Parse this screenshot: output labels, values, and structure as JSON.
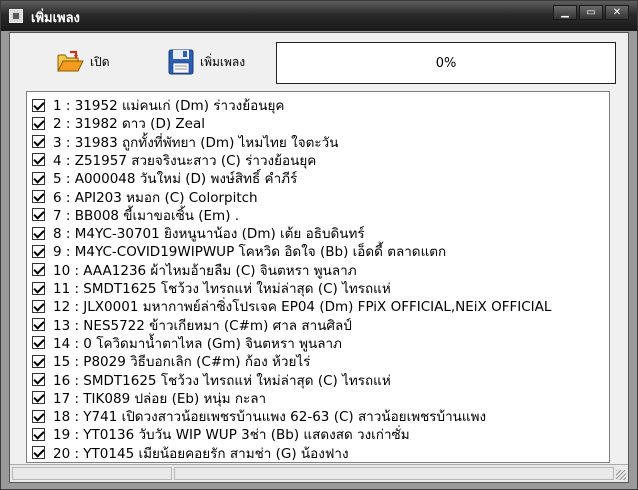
{
  "window": {
    "title": "เพิ่มเพลง",
    "controls": {
      "minimize": "▁",
      "maximize": "▭",
      "close": "✕"
    }
  },
  "toolbar": {
    "open_label": "เปิด",
    "open_icon": "folder-open-icon",
    "add_label": "เพิ่มเพลง",
    "add_icon": "floppy-disk-icon"
  },
  "progress": {
    "text": "0%",
    "value": 0
  },
  "songs": [
    {
      "text": "1 : 31952 แม่คนเก่ (Dm) ร่าวงย้อนยุค",
      "checked": true
    },
    {
      "text": "2 : 31982 ดาว  (D) Zeal",
      "checked": true
    },
    {
      "text": "3 : 31983 ถูกทั้งที่พัทยา  (Dm) ไหมไทย ใจตะวัน",
      "checked": true
    },
    {
      "text": "4 : Z51957 สวยจริงนะสาว (C) ร่าวงย้อนยุค",
      "checked": true
    },
    {
      "text": "5 : A000048 วันใหม่  (D) พงษ์สิทธิ์  คำภีร์",
      "checked": true
    },
    {
      "text": "6 : API203 หมอก (C) Colorpitch",
      "checked": true
    },
    {
      "text": "7 : BB008 ขี้เมาขอเซิ้น (Em) .",
      "checked": true
    },
    {
      "text": "8 : M4YC-30701 ยิงหนูนาน้อง (Dm) เต้ย อธิบดินทร์",
      "checked": true
    },
    {
      "text": "9 : M4YC-COVID19WIPWUP โคหวิด อิดใจ  (Bb) เอ็ดดี้ ตลาดแตก",
      "checked": true
    },
    {
      "text": "10 : AAA1236 ผ้าไหมอ้ายลืม (C) จินตหรา พูนลาภ",
      "checked": true
    },
    {
      "text": "11 : SMDT1625 โชว้วง ไทรถแห่ ใหม่ล่าสุด (C) ไทรถแห่",
      "checked": true
    },
    {
      "text": "12 : JLX0001 มหากาพย์ล่าซิ่งโปรเจค EP04 (Dm) FPiX OFFICIAL,NEiX OFFICIAL",
      "checked": true
    },
    {
      "text": "13 : NES5722 ข้าวเกียหมา (C#m) ศาล สานศิลป์",
      "checked": true
    },
    {
      "text": "14 : 0 โควิดมาน้ำตาไหล (Gm) จินตหรา พูนลาภ",
      "checked": true
    },
    {
      "text": "15 : P8029 วิธีบอกเลิก (C#m) ก้อง ห้วยไร่",
      "checked": true
    },
    {
      "text": "16 : SMDT1625 โชว้วง ไทรถแห่ ใหม่ล่าสุด (C) ไทรถแห่",
      "checked": true
    },
    {
      "text": "17 : TIK089 ปล่อย (Eb) หนุ่ม กะลา",
      "checked": true
    },
    {
      "text": "18 : Y741 เปิดวงสาวน้อยเพชรบ้านแพง 62-63 (C) สาวน้อยเพชรบ้านแพง",
      "checked": true
    },
    {
      "text": "19 : YT0136 วับวัน WIP WUP 3ช่า (Bb) แสดงสด วงเก่าซั่ม",
      "checked": true
    },
    {
      "text": "20 : YT0145 เมียน้อยคอยรัก สามช่า (G) น้องฟาง",
      "checked": true
    }
  ]
}
